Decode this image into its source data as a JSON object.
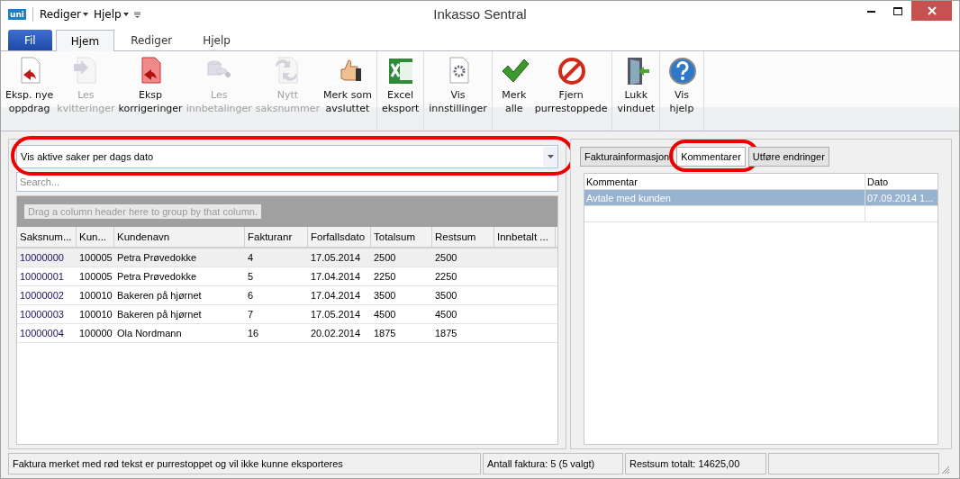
{
  "window": {
    "title": "Inkasso Sentral",
    "logo": "uni",
    "quick_menus": [
      "Rediger",
      "Hjelp"
    ]
  },
  "ribbon_tabs": [
    {
      "label": "Fil",
      "kind": "file",
      "selected": false
    },
    {
      "label": "Hjem",
      "kind": "tab",
      "selected": true
    },
    {
      "label": "Rediger",
      "kind": "tab",
      "selected": false
    },
    {
      "label": "Hjelp",
      "kind": "tab",
      "selected": false
    }
  ],
  "ribbon_groups": [
    [
      {
        "lines": [
          "Eksp. nye",
          "oppdrag"
        ],
        "disabled": false
      },
      {
        "lines": [
          "Les",
          "kvitteringer"
        ],
        "disabled": true
      },
      {
        "lines": [
          "Eksp",
          "korrigeringer"
        ],
        "disabled": false
      },
      {
        "lines": [
          "Les",
          "innbetalinger"
        ],
        "disabled": true
      },
      {
        "lines": [
          "Nytt",
          "saksnummer"
        ],
        "disabled": true
      },
      {
        "lines": [
          "Merk som",
          "avsluttet"
        ],
        "disabled": false
      }
    ],
    [
      {
        "lines": [
          "Excel",
          "eksport"
        ],
        "disabled": false
      }
    ],
    [
      {
        "lines": [
          "Vis",
          "innstillinger"
        ],
        "disabled": false
      }
    ],
    [
      {
        "lines": [
          "Merk",
          "alle"
        ],
        "disabled": false
      },
      {
        "lines": [
          "Fjern",
          "purrestoppede"
        ],
        "disabled": false
      }
    ],
    [
      {
        "lines": [
          "Lukk",
          "vinduet"
        ],
        "disabled": false
      }
    ],
    [
      {
        "lines": [
          "Vis",
          "hjelp"
        ],
        "disabled": false
      }
    ]
  ],
  "filter": {
    "value": "Vis aktive saker per dags dato",
    "circled": true
  },
  "search": {
    "placeholder": "Search..."
  },
  "group_panel": "Drag a column header here to group by that column.",
  "table": {
    "columns": [
      "Saksnum...",
      "Kun...",
      "Kundenavn",
      "Fakturanr",
      "Forfallsdato",
      "Totalsum",
      "Restsum",
      "Innbetalt ..."
    ],
    "rows": [
      {
        "selected": true,
        "cells": [
          "10000000",
          "100005",
          "Petra Prøvedokke",
          "4",
          "17.05.2014",
          "2500",
          "2500",
          ""
        ]
      },
      {
        "selected": false,
        "cells": [
          "10000001",
          "100005",
          "Petra Prøvedokke",
          "5",
          "17.04.2014",
          "2250",
          "2250",
          ""
        ]
      },
      {
        "selected": false,
        "cells": [
          "10000002",
          "100010",
          "Bakeren på hjørnet",
          "6",
          "17.04.2014",
          "3500",
          "3500",
          ""
        ]
      },
      {
        "selected": false,
        "cells": [
          "10000003",
          "100010",
          "Bakeren på hjørnet",
          "7",
          "17.05.2014",
          "4500",
          "4500",
          ""
        ]
      },
      {
        "selected": false,
        "cells": [
          "10000004",
          "100000",
          "Ola Nordmann",
          "16",
          "20.02.2014",
          "1875",
          "1875",
          ""
        ]
      }
    ]
  },
  "detail_tabs": [
    {
      "label": "Fakturainformasjon",
      "selected": false,
      "circled": false
    },
    {
      "label": "Kommentarer",
      "selected": true,
      "circled": true
    },
    {
      "label": "Utføre endringer",
      "selected": false,
      "circled": false
    }
  ],
  "comments": {
    "columns": [
      "Kommentar",
      "Dato"
    ],
    "rows": [
      {
        "selected": true,
        "cells": [
          "Avtale med kunden",
          "07.09.2014 1..."
        ]
      },
      {
        "selected": false,
        "cells": [
          "",
          ""
        ]
      }
    ]
  },
  "status_bar": [
    "Faktura merket med rød tekst er purrestoppet og vil ikke kunne eksporteres",
    "Antall faktura: 5 (5 valgt)",
    "Restsum totalt: 14625,00"
  ]
}
